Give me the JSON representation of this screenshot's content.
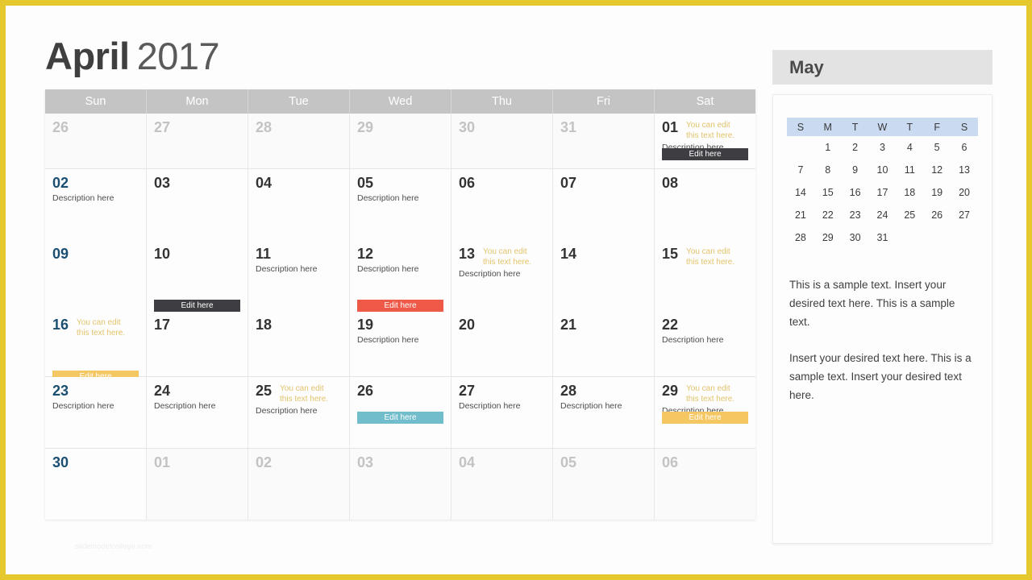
{
  "slide": {
    "border_color": "#e5c72e",
    "background": "#fdfdfd",
    "watermark": "slidemodelcollege.com"
  },
  "header": {
    "month_name": "April",
    "year": "2017"
  },
  "calendar": {
    "day_headers": [
      "Sun",
      "Mon",
      "Tue",
      "Wed",
      "Thu",
      "Fri",
      "Sat"
    ],
    "header_bg": "#c4c4c4",
    "weeks": [
      {
        "height": "short",
        "cells": [
          {
            "num": "26",
            "muted": true
          },
          {
            "num": "27",
            "muted": true
          },
          {
            "num": "28",
            "muted": true
          },
          {
            "num": "29",
            "muted": true
          },
          {
            "num": "30",
            "muted": true
          },
          {
            "num": "31",
            "muted": true
          },
          {
            "num": "01",
            "note": "You can edit this text here.",
            "desc": "Description here",
            "button": {
              "label": "Edit here",
              "color": "dark"
            }
          }
        ]
      },
      {
        "height": "mega",
        "cells": [
          {
            "entries": [
              {
                "num": "02",
                "sunday": true,
                "desc": "Description here"
              },
              {
                "num": "09",
                "sunday": true
              },
              {
                "num": "16",
                "sunday": true,
                "note": "You can edit this text here.",
                "button": {
                  "label": "Edit here",
                  "color": "gold"
                }
              }
            ]
          },
          {
            "entries": [
              {
                "num": "03"
              },
              {
                "num": "10",
                "button": {
                  "label": "Edit here",
                  "color": "dark"
                }
              },
              {
                "num": "17"
              }
            ]
          },
          {
            "entries": [
              {
                "num": "04"
              },
              {
                "num": "11",
                "desc": "Description here"
              },
              {
                "num": "18"
              }
            ]
          },
          {
            "entries": [
              {
                "num": "05",
                "desc": "Description here"
              },
              {
                "num": "12",
                "desc": "Description here",
                "button": {
                  "label": "Edit here",
                  "color": "red"
                }
              },
              {
                "num": "19",
                "desc": "Description here"
              }
            ]
          },
          {
            "entries": [
              {
                "num": "06"
              },
              {
                "num": "13",
                "note": "You can edit this text here.",
                "desc": "Description here"
              },
              {
                "num": "20"
              }
            ]
          },
          {
            "entries": [
              {
                "num": "07"
              },
              {
                "num": "14"
              },
              {
                "num": "21"
              }
            ]
          },
          {
            "entries": [
              {
                "num": "08"
              },
              {
                "num": "15",
                "note": "You can edit this text here."
              },
              {
                "num": "22",
                "desc": "Description here"
              }
            ]
          }
        ]
      },
      {
        "height": "tall",
        "cells": [
          {
            "num": "23",
            "sunday": true,
            "desc": "Description here"
          },
          {
            "num": "24",
            "desc": "Description here"
          },
          {
            "num": "25",
            "note": "You can edit this text here.",
            "desc": "Description here"
          },
          {
            "num": "26",
            "button": {
              "label": "Edit here",
              "color": "teal"
            }
          },
          {
            "num": "27",
            "desc": "Description here"
          },
          {
            "num": "28",
            "desc": "Description here"
          },
          {
            "num": "29",
            "note": "You can edit this text here.",
            "desc": "Description here",
            "button": {
              "label": "Edit here",
              "color": "gold"
            }
          }
        ]
      },
      {
        "height": "tall",
        "cells": [
          {
            "num": "30",
            "sunday": true
          },
          {
            "num": "01",
            "muted": true
          },
          {
            "num": "02",
            "muted": true
          },
          {
            "num": "03",
            "muted": true
          },
          {
            "num": "04",
            "muted": true
          },
          {
            "num": "05",
            "muted": true
          },
          {
            "num": "06",
            "muted": true
          }
        ]
      }
    ]
  },
  "sidebar": {
    "title": "May",
    "mini_calendar": {
      "day_headers": [
        "S",
        "M",
        "T",
        "W",
        "T",
        "F",
        "S"
      ],
      "header_bg": "#c9daf1",
      "rows": [
        [
          "",
          "1",
          "2",
          "3",
          "4",
          "5",
          "6"
        ],
        [
          "7",
          "8",
          "9",
          "10",
          "11",
          "12",
          "13"
        ],
        [
          "14",
          "15",
          "16",
          "17",
          "18",
          "19",
          "20"
        ],
        [
          "21",
          "22",
          "23",
          "24",
          "25",
          "26",
          "27"
        ],
        [
          "28",
          "29",
          "30",
          "31",
          "",
          "",
          ""
        ]
      ]
    },
    "paragraph_1": "This is a sample text. Insert your desired text here. This is a sample text.",
    "paragraph_2": "Insert your desired text here. This is a sample text. Insert your desired text here."
  }
}
